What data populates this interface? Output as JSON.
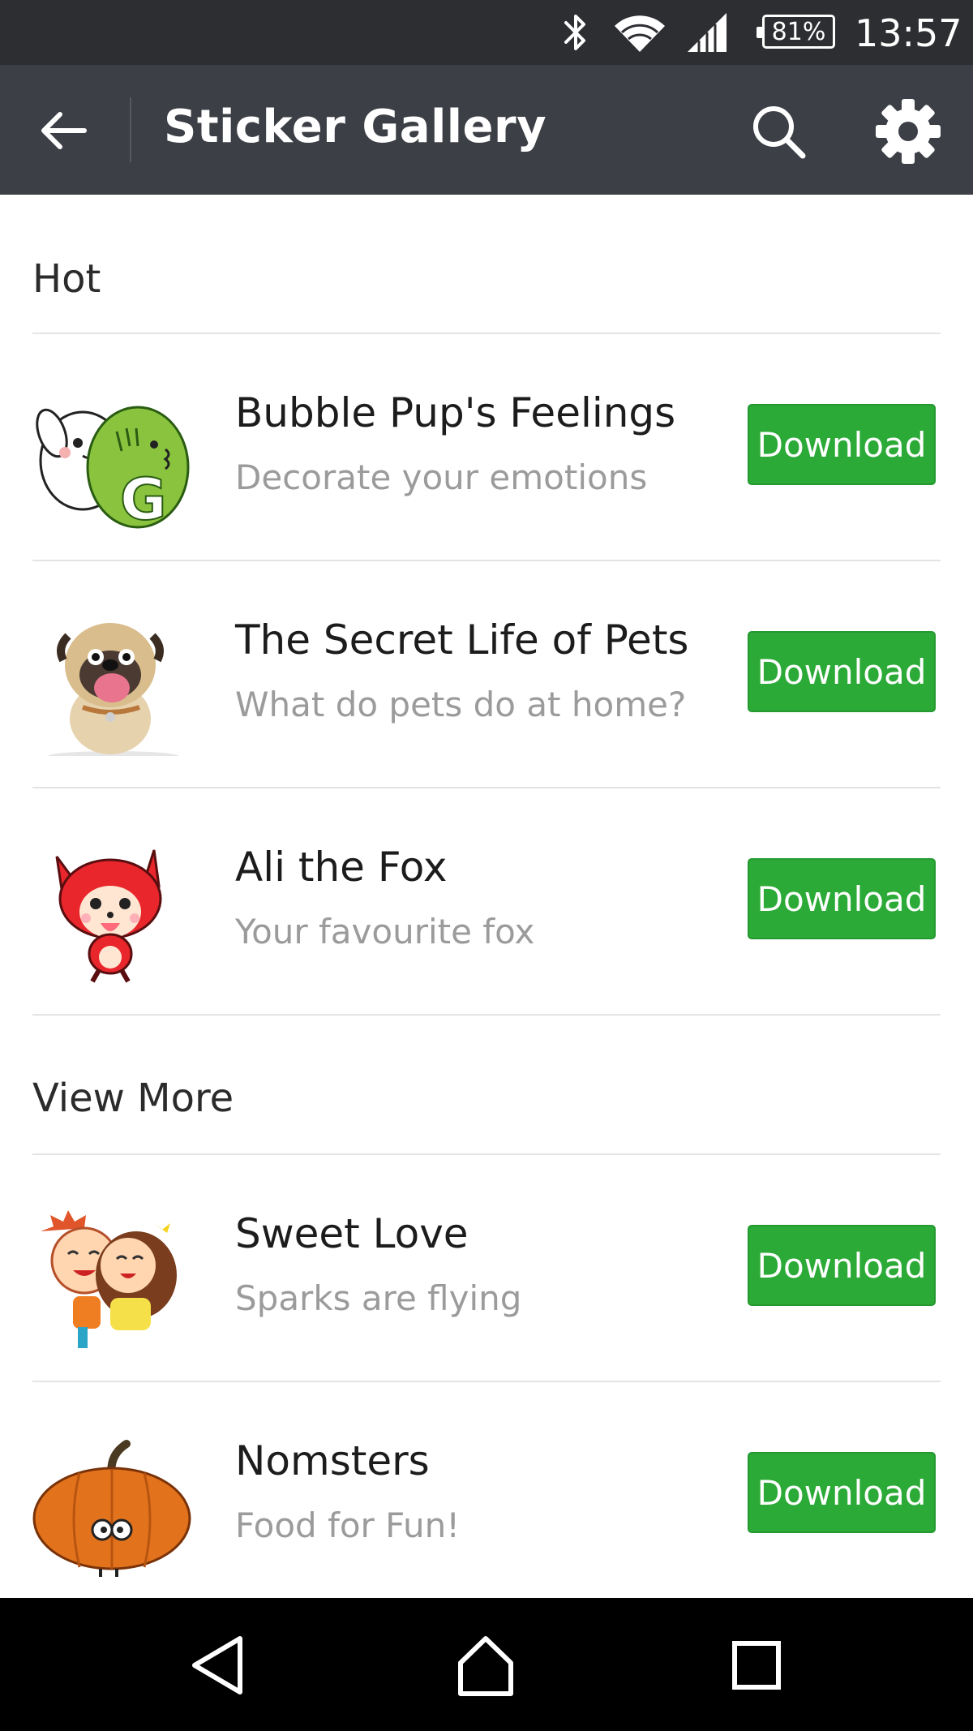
{
  "status_bar": {
    "battery": "81%",
    "time": "13:57",
    "icons": [
      "bluetooth-icon",
      "wifi-icon",
      "signal-icon",
      "battery-icon"
    ]
  },
  "app_bar": {
    "title": "Sticker Gallery",
    "icons": [
      "back-arrow-icon",
      "search-icon",
      "gear-icon"
    ],
    "background": "#3c3f45"
  },
  "sections": {
    "hot": {
      "header": "Hot",
      "items": [
        {
          "title": "Bubble Pup's Feelings",
          "subtitle": "Decorate your emotions",
          "button": "Download",
          "thumb": "bubble-pup-sticker"
        },
        {
          "title": "The Secret Life of Pets",
          "subtitle": "What do pets do at home?",
          "button": "Download",
          "thumb": "pug-sticker"
        },
        {
          "title": "Ali the Fox",
          "subtitle": "Your favourite fox",
          "button": "Download",
          "thumb": "red-fox-sticker"
        }
      ]
    },
    "more": {
      "header": "View More",
      "items": [
        {
          "title": "Sweet Love",
          "subtitle": "Sparks are flying",
          "button": "Download",
          "thumb": "hugging-couple-sticker"
        },
        {
          "title": "Nomsters",
          "subtitle": "Food for Fun!",
          "button": "Download",
          "thumb": "pumpkin-sticker"
        }
      ]
    }
  },
  "colors": {
    "accent_green": "#2caa37",
    "status_bar": "#2c2e31",
    "nav_bar": "#000000"
  },
  "nav_bar": {
    "icons": [
      "nav-back-icon",
      "nav-home-icon",
      "nav-recents-icon"
    ]
  }
}
